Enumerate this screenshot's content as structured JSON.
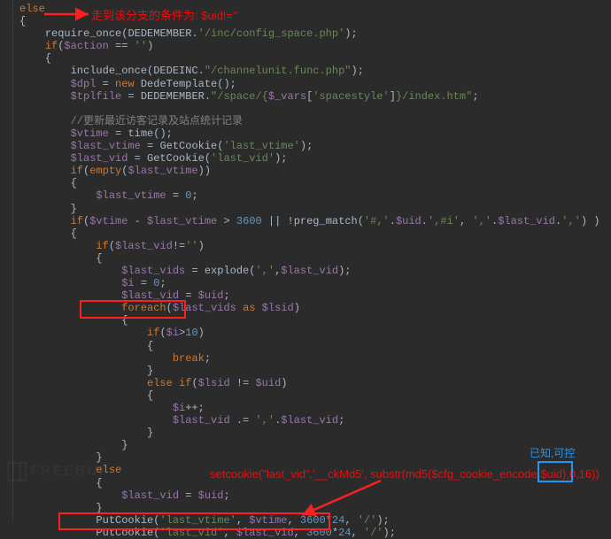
{
  "annotations": {
    "top_red": "走到该分支的条件为: $uid!=''",
    "bottom_red": "setcookie(\"last_vid\".'__ckMd5', substr(md5($cfg_cookie_encode.$uid),0,16))",
    "blue": "已知,可控"
  },
  "watermark": "FREEBUF",
  "chart_data": {
    "type": "table",
    "title": "PHP source snippet (DedeCMS member space)",
    "language": "php",
    "highlighted_lines": [
      "$last_vid = $uid;",
      "PutCookie('last_vid', $last_vid, 3600*24, '/');"
    ],
    "lines": [
      "else",
      "{",
      "    require_once(DEDEMEMBER.'/inc/config_space.php');",
      "    if($action == '')",
      "    {",
      "        include_once(DEDEINC.\"/channelunit.func.php\");",
      "        $dpl = new DedeTemplate();",
      "        $tplfile = DEDEMEMBER.\"/space/{$_vars['spacestyle']}/index.htm\";",
      "",
      "        //更新最近访客记录及站点统计记录",
      "        $vtime = time();",
      "        $last_vtime = GetCookie('last_vtime');",
      "        $last_vid = GetCookie('last_vid');",
      "        if(empty($last_vtime))",
      "        {",
      "            $last_vtime = 0;",
      "        }",
      "        if($vtime - $last_vtime > 3600 || !preg_match('#,'.$uid.',#i', ','.$last_vid.',') )",
      "        {",
      "            if($last_vid!='')",
      "            {",
      "                $last_vids = explode(',',$last_vid);",
      "                $i = 0;",
      "                $last_vid = $uid;",
      "                foreach($last_vids as $lsid)",
      "                {",
      "                    if($i>10)",
      "                    {",
      "                        break;",
      "                    }",
      "                    else if($lsid != $uid)",
      "                    {",
      "                        $i++;",
      "                        $last_vid .= ','.$last_vid;",
      "                    }",
      "                }",
      "            }",
      "            else",
      "            {",
      "                $last_vid = $uid;",
      "            }",
      "            PutCookie('last_vtime', $vtime, 3600*24, '/');",
      "            PutCookie('last_vid', $last_vid, 3600*24, '/');"
    ]
  }
}
